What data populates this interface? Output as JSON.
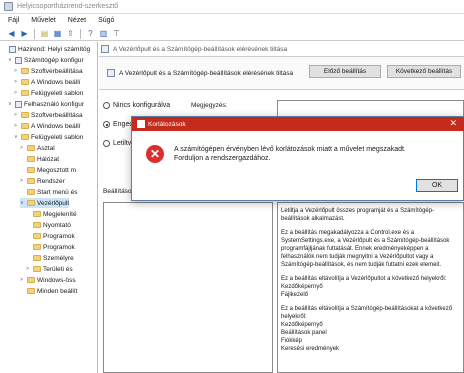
{
  "window": {
    "title": "Helyicsoportházirend-szerkesztő"
  },
  "menu": [
    "Fájl",
    "Művelet",
    "Nézet",
    "Súgó"
  ],
  "toolbar_icons": [
    "back-icon",
    "forward-icon",
    "folder-up-icon",
    "show-tree-icon",
    "export-icon",
    "help-icon",
    "properties-icon",
    "filter-icon"
  ],
  "tree": [
    {
      "label": "Házirend: Helyi számítóg",
      "indent": 0,
      "type": "policy",
      "arrow": ""
    },
    {
      "label": "Számítógép konfigur",
      "indent": 1,
      "type": "policy",
      "arrow": "∨"
    },
    {
      "label": "Szoftverbeállítása",
      "indent": 2,
      "type": "folder",
      "arrow": ">"
    },
    {
      "label": "A Windows beállí",
      "indent": 2,
      "type": "folder",
      "arrow": ">"
    },
    {
      "label": "Felügyeleti sablon",
      "indent": 2,
      "type": "folder",
      "arrow": ">"
    },
    {
      "label": "Felhasználó konfigur",
      "indent": 1,
      "type": "policy",
      "arrow": "∨"
    },
    {
      "label": "Szoftverbeállítása",
      "indent": 2,
      "type": "folder",
      "arrow": ">"
    },
    {
      "label": "A Windows beállí",
      "indent": 2,
      "type": "folder",
      "arrow": ">"
    },
    {
      "label": "Felügyeleti sablon",
      "indent": 2,
      "type": "folder",
      "arrow": "∨"
    },
    {
      "label": "Asztal",
      "indent": 3,
      "type": "folder",
      "arrow": ">"
    },
    {
      "label": "Hálózat",
      "indent": 3,
      "type": "folder",
      "arrow": ""
    },
    {
      "label": "Megosztott m",
      "indent": 3,
      "type": "folder",
      "arrow": ""
    },
    {
      "label": "Rendszer",
      "indent": 3,
      "type": "folder",
      "arrow": ">"
    },
    {
      "label": "Start menü és",
      "indent": 3,
      "type": "folder",
      "arrow": ""
    },
    {
      "label": "Vezérlőpult",
      "indent": 3,
      "type": "folder",
      "arrow": "∨",
      "selected": true
    },
    {
      "label": "Megjeleníté",
      "indent": 4,
      "type": "folder",
      "arrow": ""
    },
    {
      "label": "Nyomtató",
      "indent": 4,
      "type": "folder",
      "arrow": ""
    },
    {
      "label": "Programok",
      "indent": 4,
      "type": "folder",
      "arrow": ""
    },
    {
      "label": "Programok",
      "indent": 4,
      "type": "folder",
      "arrow": ""
    },
    {
      "label": "Személyre",
      "indent": 4,
      "type": "folder",
      "arrow": ""
    },
    {
      "label": "Területi és",
      "indent": 4,
      "type": "folder",
      "arrow": ">"
    },
    {
      "label": "Windows-öss",
      "indent": 3,
      "type": "folder",
      "arrow": ">"
    },
    {
      "label": "Minden beállít",
      "indent": 3,
      "type": "folder",
      "arrow": ""
    }
  ],
  "policy": {
    "subtitle": "A Vezérlőpult és a Számítógép-beállítások elérésének tiltása",
    "header_title": "A Vezérlőpult és a Számítógép-beállítások elérésének tiltása",
    "prev_button": "Előző beállítás",
    "next_button": "Következő beállítás",
    "options": [
      {
        "label": "Nincs konfigurálva",
        "checked": false
      },
      {
        "label": "Engedélyezve",
        "checked": true
      },
      {
        "label": "Letiltva",
        "checked": false
      }
    ],
    "comment_label": "Megjegyzés:",
    "settings_label": "Beállítások:",
    "help_text": [
      "Letiltja a Vezérlőpult összes programját és a Számítógép-beállítások alkalmazást.",
      "Ez a beállítás megakadályozza a Control.exe és a SystemSettings.exe, a Vezérlőpult és a Számítógép-beállítások programfájljának futtatását. Ennek eredményeképpen a felhasználók nem tudják megnyitni a Vezérlőpultot vagy a Számítógép-beállítások, és nem tudják futtatni ezek elemeit.",
      "Ez a beállítás eltávolítja a Vezérlőpultot a következő helyekről:",
      "Kezdőképernyő",
      "Fájlkezelő",
      "Ez a beállítás eltávolítja a Számítógép-beállításokat a következő helyekről:",
      "Kezdőképernyő",
      "Beállítások panel",
      "Fiókkép",
      "Keresési eredmények"
    ]
  },
  "dialog": {
    "title": "Korlátozások",
    "message": "A számítógépen érvényben lévő korlátozások miatt a művelet megszakadt. Forduljon a rendszergazdához.",
    "ok_label": "OK"
  }
}
